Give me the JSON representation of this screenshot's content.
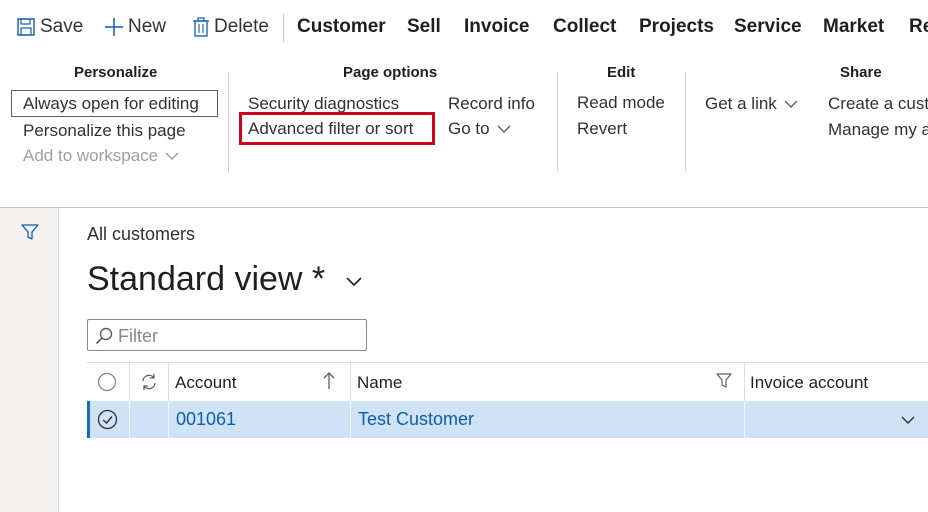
{
  "toolbar": {
    "save": "Save",
    "new": "New",
    "delete": "Delete",
    "tabs": [
      "Customer",
      "Sell",
      "Invoice",
      "Collect",
      "Projects",
      "Service",
      "Market",
      "Re"
    ]
  },
  "ribbon": {
    "personalize": {
      "title": "Personalize",
      "always_open": "Always open for editing",
      "personalize_page": "Personalize this page",
      "add_to_workspace": "Add to workspace"
    },
    "page_options": {
      "title": "Page options",
      "security_diagnostics": "Security diagnostics",
      "advanced_filter": "Advanced filter or sort",
      "record_info": "Record info",
      "go_to": "Go to"
    },
    "edit": {
      "title": "Edit",
      "read_mode": "Read mode",
      "revert": "Revert"
    },
    "get_a_link": "Get a link",
    "share": {
      "title": "Share",
      "create": "Create a cust",
      "manage": "Manage my a"
    }
  },
  "content": {
    "breadcrumb": "All customers",
    "view_title": "Standard view *",
    "filter_placeholder": "Filter"
  },
  "grid": {
    "columns": [
      "Account",
      "Name",
      "Invoice account"
    ],
    "rows": [
      {
        "account": "001061",
        "name": "Test Customer",
        "invoice_account": ""
      }
    ]
  },
  "colors": {
    "highlight_box": "#d0021b",
    "selected_row": "#cfe2f6",
    "link_blue": "#0f5cad",
    "accent": "#106ebe"
  }
}
